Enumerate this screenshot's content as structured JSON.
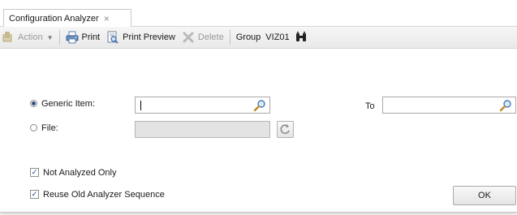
{
  "tab": {
    "title": "Configuration Analyzer",
    "close_glyph": "×"
  },
  "toolbar": {
    "action_label": "Action",
    "print_label": "Print",
    "print_preview_label": "Print Preview",
    "delete_label": "Delete",
    "group_label": "Group",
    "group_value": "VIZ01"
  },
  "form": {
    "generic_item_label": "Generic Item:",
    "generic_item_value": "",
    "generic_item_selected": true,
    "to_label": "To",
    "to_value": "",
    "file_label": "File:",
    "file_value": "",
    "file_selected": false,
    "not_analyzed_only_label": "Not Analyzed Only",
    "not_analyzed_only_checked": true,
    "reuse_sequence_label": "Reuse Old Analyzer Sequence",
    "reuse_sequence_checked": true
  },
  "buttons": {
    "ok_label": "OK"
  },
  "icons": {
    "action": "action-icon",
    "print": "printer-icon",
    "print_preview": "print-preview-icon",
    "delete": "delete-x-icon",
    "group": "binoculars-icon",
    "search": "magnifier-icon",
    "file_browse": "folder-refresh-icon"
  },
  "colors": {
    "accent": "#2f4e84",
    "disabled_text": "#9b9b9b",
    "disabled_field": "#e3e3e3"
  }
}
